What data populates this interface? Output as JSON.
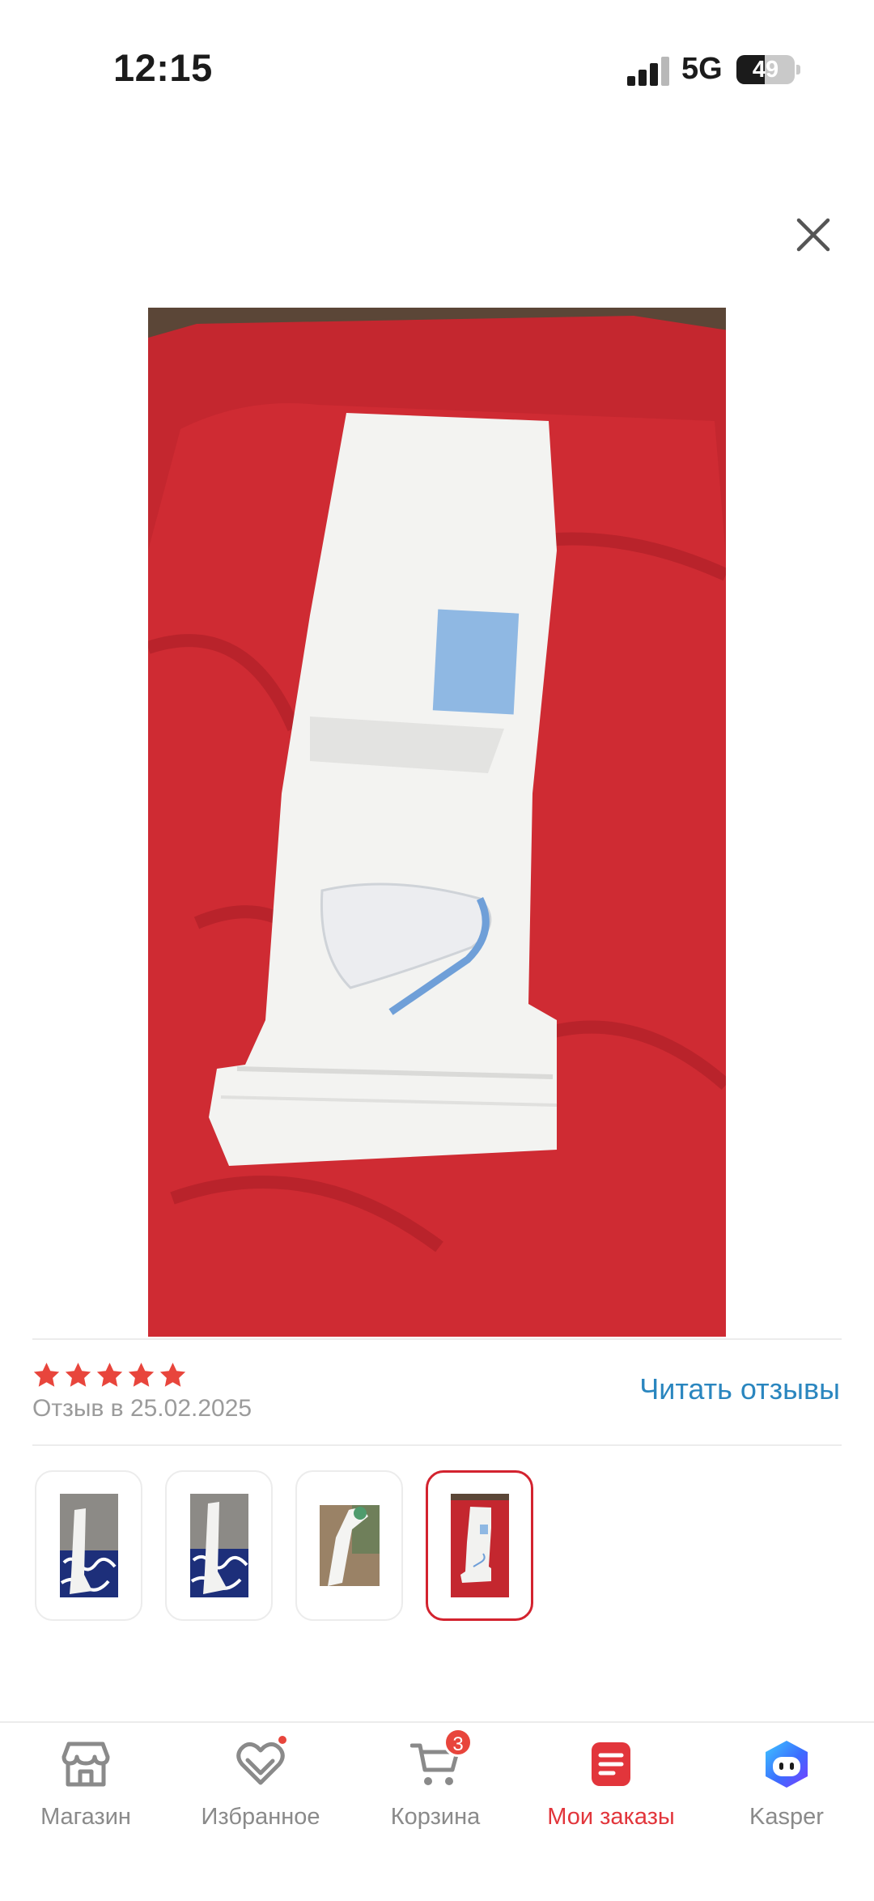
{
  "status_bar": {
    "time": "12:15",
    "network": "5G",
    "battery": "49",
    "battery_level": 0.49
  },
  "review": {
    "rating": 5,
    "date_label": "Отзыв в 25.02.2025",
    "read_reviews_label": "Читать отзывы",
    "selected_thumbnail": 4
  },
  "tabbar": {
    "shop": "Магазин",
    "favorites": "Избранное",
    "cart": "Корзина",
    "cart_count": "3",
    "orders": "Мои заказы",
    "kasper": "Kasper"
  },
  "colors": {
    "accent": "#e2353b",
    "link": "#2a86bf",
    "star": "#e8453c"
  },
  "icons": [
    "close-icon",
    "star-icon",
    "store-icon",
    "heart-icon",
    "cart-icon",
    "orders-icon",
    "kasper-icon"
  ]
}
